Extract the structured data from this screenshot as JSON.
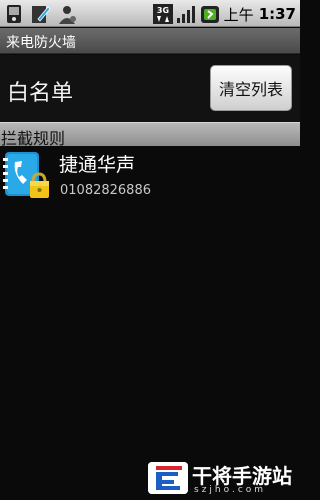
{
  "status_bar": {
    "network": "3G",
    "ampm": "上午",
    "time": "1:37",
    "icons": [
      "phone-memory-icon",
      "edit-note-icon",
      "person-icon",
      "3g-icon",
      "signal-icon",
      "battery-icon"
    ]
  },
  "title_bar": {
    "title": "来电防火墙"
  },
  "whitelist": {
    "label": "白名单",
    "clear_button": "清空列表"
  },
  "section": {
    "title": "拦截规则"
  },
  "rules": [
    {
      "name": "捷通华声",
      "number": "01082826886",
      "icon": "locked-phone-book-icon"
    }
  ],
  "watermark": {
    "title": "干将手游站",
    "subtitle": "szjho.com",
    "badge_text": "e"
  },
  "colors": {
    "background": "#0a0a0a",
    "title_bar": "#4a4a4a",
    "section_header": "#9a9a9a",
    "accent_icon": "#2aa9e8"
  }
}
